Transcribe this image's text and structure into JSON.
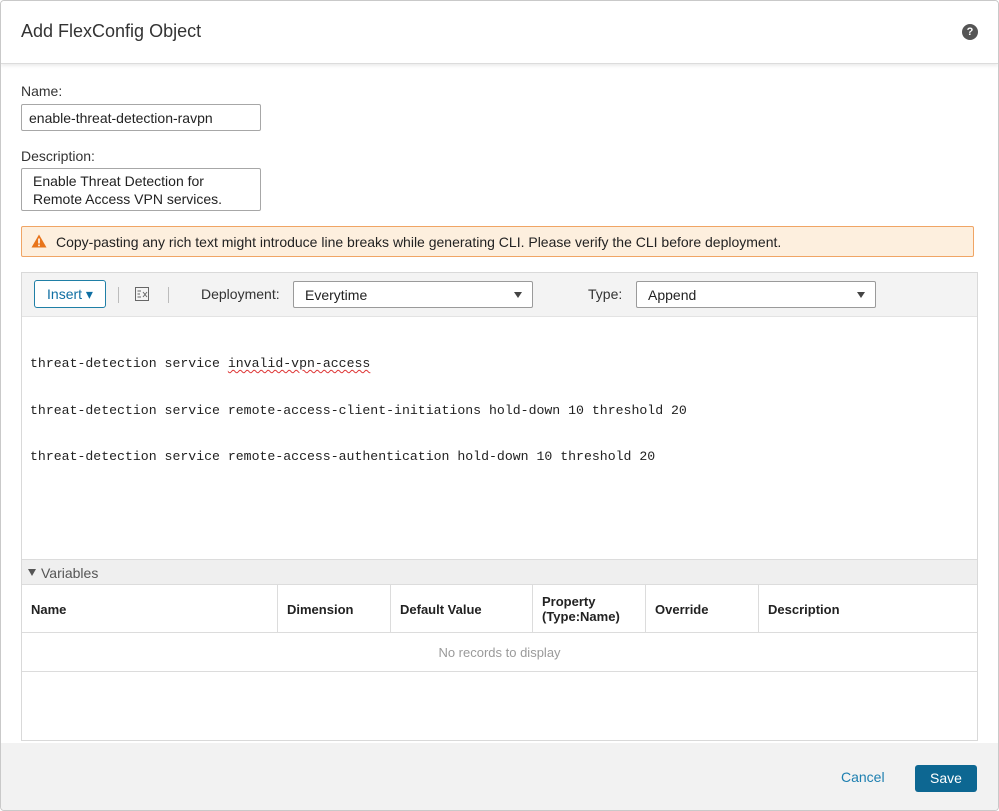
{
  "dialog": {
    "title": "Add FlexConfig Object",
    "help_icon": "question-circle-icon",
    "help_glyph": "?"
  },
  "form": {
    "name_label": "Name:",
    "name_value": "enable-threat-detection-ravpn",
    "description_label": "Description:",
    "description_value": "Enable Threat Detection for\nRemote Access VPN services."
  },
  "warning": {
    "icon": "warning-triangle-icon",
    "text": "Copy-pasting any rich text might introduce line breaks while generating CLI. Please verify the CLI before deployment.",
    "color": "#f0a565"
  },
  "toolbar": {
    "insert_label": "Insert ▾",
    "clear_icon": "clear-format-icon",
    "deployment_label": "Deployment:",
    "deployment_value": "Everytime",
    "type_label": "Type:",
    "type_value": "Append"
  },
  "editor": {
    "line1_prefix": "threat-detection service ",
    "line1_flagged": "invalid-vpn-access",
    "line2": "threat-detection service remote-access-client-initiations hold-down 10 threshold 20",
    "line3": "threat-detection service remote-access-authentication hold-down 10 threshold 20"
  },
  "variables": {
    "section_label": "Variables",
    "columns": [
      "Name",
      "Dimension",
      "Default Value",
      "Property\n(Type:Name)",
      "Override",
      "Description"
    ],
    "empty_message": "No records to display"
  },
  "footer": {
    "cancel_label": "Cancel",
    "save_label": "Save",
    "primary_color": "#0d6792"
  }
}
